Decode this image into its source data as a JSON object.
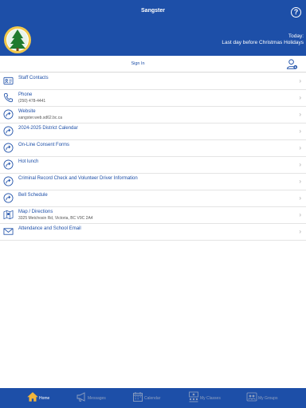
{
  "header": {
    "title": "Sangster"
  },
  "banner": {
    "today_label": "Today:",
    "today_text": "Last day before Christmas Holidays"
  },
  "signin": {
    "label": "Sign In"
  },
  "menu": [
    {
      "title": "Staff Contacts",
      "subtitle": "",
      "icon": "contact-card-icon"
    },
    {
      "title": "Phone",
      "subtitle": "(250) 478-4441",
      "icon": "phone-icon"
    },
    {
      "title": "Website",
      "subtitle": "sangster.web.sd62.bc.ca",
      "icon": "share-arrow-icon"
    },
    {
      "title": "2024-2025 District Calendar",
      "subtitle": "",
      "icon": "share-arrow-icon"
    },
    {
      "title": "On-Line Consent Forms",
      "subtitle": "",
      "icon": "share-arrow-icon"
    },
    {
      "title": "Hot lunch",
      "subtitle": "",
      "icon": "share-arrow-icon"
    },
    {
      "title": "Criminal Record Check and Volunteer Driver Information",
      "subtitle": "",
      "icon": "share-arrow-icon"
    },
    {
      "title": "Bell Schedule",
      "subtitle": "",
      "icon": "share-arrow-icon"
    },
    {
      "title": "Map / Directions",
      "subtitle": "3325 Metchosin Rd, Victoria, BC V9C 2A4",
      "icon": "map-icon"
    },
    {
      "title": "Attendance and School Email",
      "subtitle": "",
      "icon": "email-icon"
    }
  ],
  "tabs": [
    {
      "label": "Home",
      "icon": "home-icon",
      "active": true
    },
    {
      "label": "Messages",
      "icon": "megaphone-icon",
      "active": false
    },
    {
      "label": "Calendar",
      "icon": "calendar-icon",
      "active": false
    },
    {
      "label": "My Classes",
      "icon": "classes-icon",
      "active": false
    },
    {
      "label": "My Groups",
      "icon": "groups-icon",
      "active": false
    }
  ],
  "colors": {
    "brand": "#1d4fa8",
    "active_tab_icon": "#f2b53a",
    "inactive_tab": "#8fa0c0",
    "logo_ring": "#f2c84b",
    "logo_tree": "#1f7a2e"
  }
}
